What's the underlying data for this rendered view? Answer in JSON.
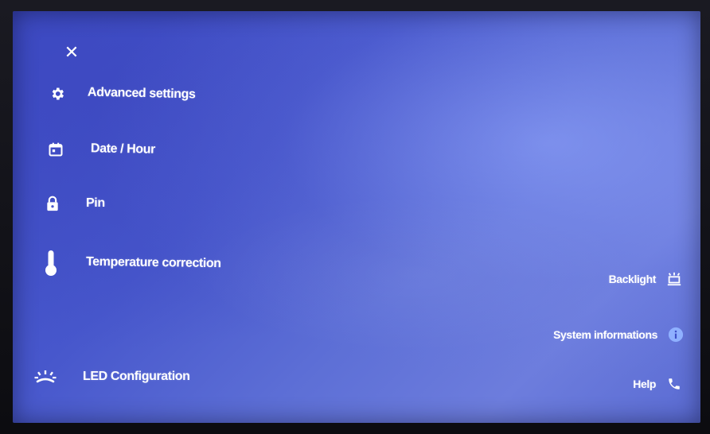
{
  "menu": {
    "items": [
      {
        "label": "Advanced settings",
        "icon": "gear-icon"
      },
      {
        "label": "Date / Hour",
        "icon": "calendar-icon"
      },
      {
        "label": "Pin",
        "icon": "lock-icon"
      },
      {
        "label": "Temperature correction",
        "icon": "thermometer-icon"
      },
      {
        "label": "LED Configuration",
        "icon": "led-icon"
      }
    ]
  },
  "side": {
    "backlight_label": "Backlight",
    "system_info_label": "System informations",
    "help_label": "Help"
  },
  "colors": {
    "background": "#4757cc",
    "text": "#ffffff",
    "info_icon": "#8fb0ff"
  }
}
